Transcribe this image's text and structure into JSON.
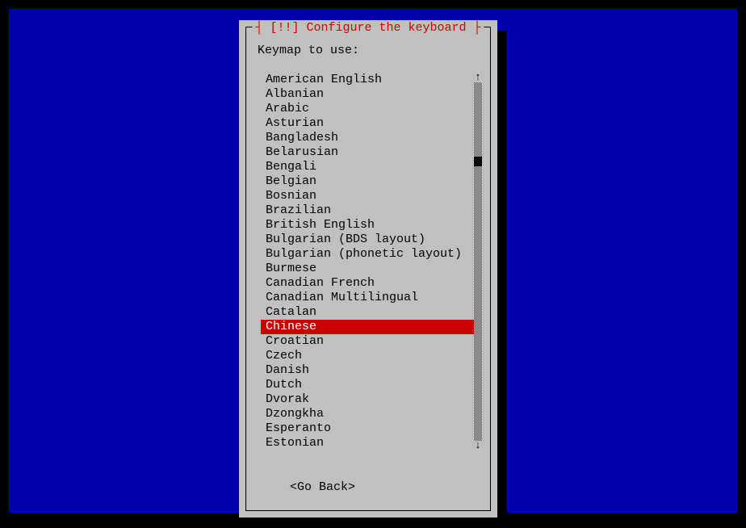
{
  "dialog": {
    "title": "[!!] Configure the keyboard",
    "prompt": "Keymap to use:",
    "go_back": "<Go Back>"
  },
  "list": {
    "items": [
      "American English",
      "Albanian",
      "Arabic",
      "Asturian",
      "Bangladesh",
      "Belarusian",
      "Bengali",
      "Belgian",
      "Bosnian",
      "Brazilian",
      "British English",
      "Bulgarian (BDS layout)",
      "Bulgarian (phonetic layout)",
      "Burmese",
      "Canadian French",
      "Canadian Multilingual",
      "Catalan",
      "Chinese",
      "Croatian",
      "Czech",
      "Danish",
      "Dutch",
      "Dvorak",
      "Dzongkha",
      "Esperanto",
      "Estonian"
    ],
    "selected": "Chinese"
  },
  "scroll": {
    "up_glyph": "↑",
    "down_glyph": "↓"
  },
  "colors": {
    "background": "#000000",
    "desktop": "#0000aa",
    "dialog": "#c0c0c0",
    "title": "#cc0000",
    "selected": "#cc0000"
  }
}
